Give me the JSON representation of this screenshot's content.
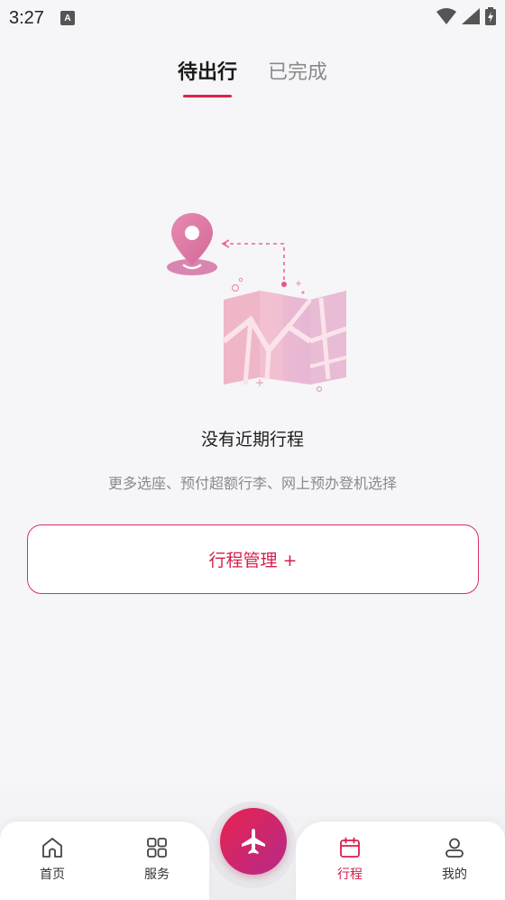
{
  "status_bar": {
    "time": "3:27",
    "notification_icon": "A"
  },
  "tabs": [
    {
      "label": "待出行",
      "active": true
    },
    {
      "label": "已完成",
      "active": false
    }
  ],
  "empty_state": {
    "title": "没有近期行程",
    "subtitle": "更多选座、预付超额行李、网上预办登机选择",
    "button_label": "行程管理 +"
  },
  "bottom_nav": {
    "items": [
      {
        "label": "首页",
        "icon": "home-icon",
        "active": false
      },
      {
        "label": "服务",
        "icon": "grid-icon",
        "active": false
      },
      {
        "label": "行程",
        "icon": "calendar-icon",
        "active": true
      },
      {
        "label": "我的",
        "icon": "user-icon",
        "active": false
      }
    ],
    "center_icon": "airplane-icon"
  },
  "colors": {
    "accent": "#e0204a",
    "gradient_end": "#b52a8a",
    "background": "#f6f5f8"
  }
}
